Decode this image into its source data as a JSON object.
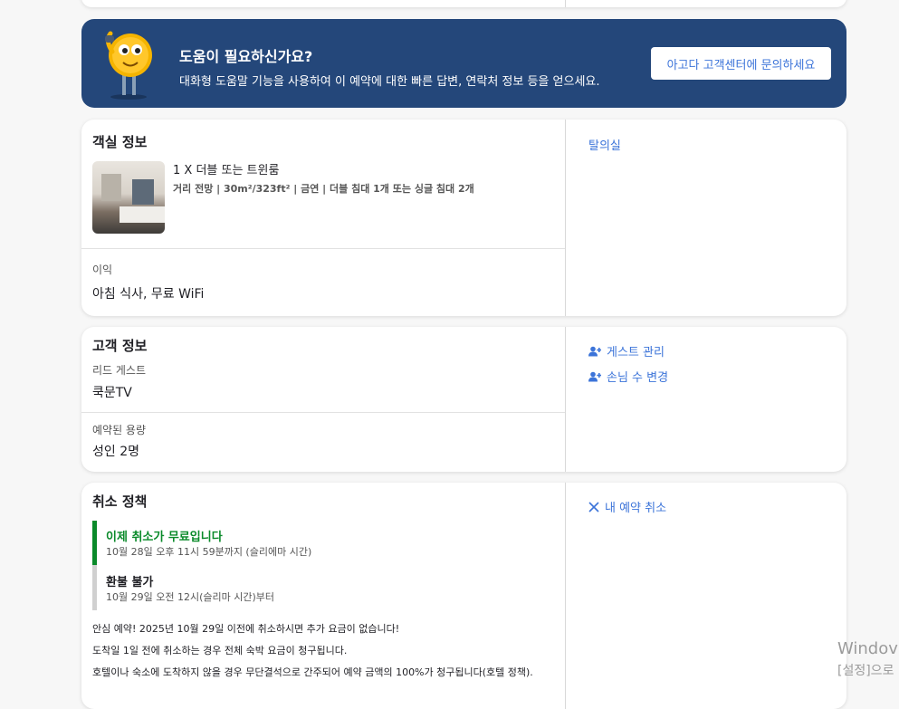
{
  "colors": {
    "accent": "#3c74d9",
    "banner": "#24477a",
    "free_cancel": "#0a8a2a",
    "no_refund": "#d0d0d0"
  },
  "help": {
    "title": "도움이 필요하신가요?",
    "subtitle": "대화형 도움말 기능을 사용하여 이 예약에 대한 빠른 답변, 연락처 정보 등을 얻으세요.",
    "button": "아고다 고객센터에 문의하세요"
  },
  "room": {
    "section_title": "객실 정보",
    "room_name": "1 X 더블 또는 트윈룸",
    "room_details": "거리 전망 | 30m²/323ft² | 금연 | 더블 침대 1개 또는 싱글 침대 2개",
    "benefits_label": "이익",
    "benefits_value": "아침 식사, 무료 WiFi",
    "side_link": "탈의실"
  },
  "guest": {
    "section_title": "고객 정보",
    "lead_label": "리드 게스트",
    "lead_value": "쿡문TV",
    "capacity_label": "예약된 용량",
    "capacity_value": "성인 2명",
    "manage_link": "게스트 관리",
    "change_link": "손님 수 변경"
  },
  "cancel": {
    "section_title": "취소 정책",
    "free_title": "이제 취소가 무료입니다",
    "free_until": "10월 28일 오후 11시 59분까지 (슬리에마 시간)",
    "norefund_title": "환불 불가",
    "norefund_from": "10월 29일 오전 12시(슬리마 시간)부터",
    "note1": "안심 예약! 2025년 10월 29일 이전에 취소하시면 추가 요금이 없습니다!",
    "note2": "도착일 1일 전에 취소하는 경우 전체 숙박 요금이 청구됩니다.",
    "note3": "호텔이나 숙소에 도착하지 않을 경우 무단결석으로 간주되어 예약 금액의 100%가 청구됩니다(호텔 정책).",
    "cancel_link": "내 예약 취소"
  },
  "watermark": {
    "line1": "Windov",
    "line2": "[설정]으로"
  }
}
